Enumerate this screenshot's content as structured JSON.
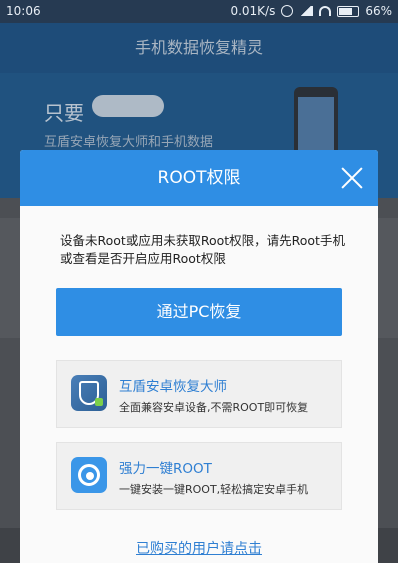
{
  "status_bar": {
    "time": "10:06",
    "speed": "0.01K/s",
    "battery": "66%"
  },
  "app": {
    "title": "手机数据恢复精灵",
    "banner_text": "只要",
    "banner_sub": "互盾安卓恢复大师和手机数据"
  },
  "dialog": {
    "title": "ROOT权限",
    "message": "设备未Root或应用未获取Root权限，请先Root手机或查看是否开启应用Root权限",
    "primary_button": "通过PC恢复",
    "options": [
      {
        "title": "互盾安卓恢复大师",
        "desc": "全面兼容安卓设备,不需ROOT即可恢复",
        "icon": "shield-phone-icon"
      },
      {
        "title": "强力一键ROOT",
        "desc": "一键安装一键ROOT,轻松搞定安卓手机",
        "icon": "root-icon"
      }
    ],
    "link": "已购买的用户请点击"
  },
  "colors": {
    "accent": "#2f8ee4",
    "link": "#2f7fd2"
  }
}
